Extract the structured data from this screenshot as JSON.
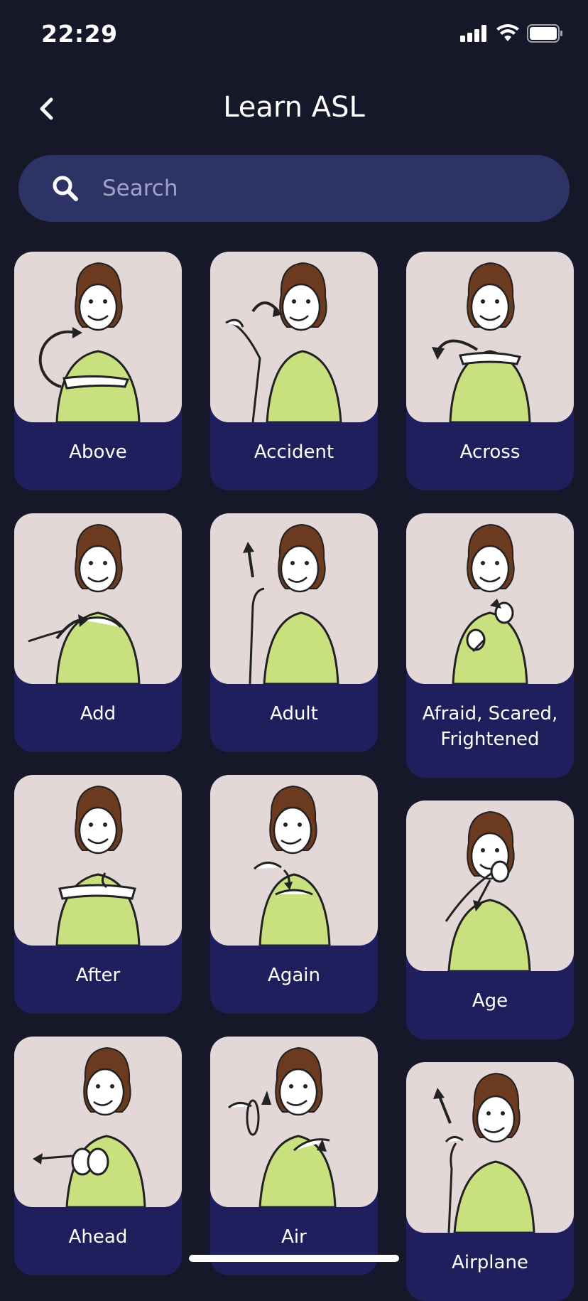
{
  "status": {
    "time": "22:29"
  },
  "header": {
    "title": "Learn ASL"
  },
  "search": {
    "placeholder": "Search"
  },
  "signs": [
    {
      "label": "Above"
    },
    {
      "label": "Accident"
    },
    {
      "label": "Across"
    },
    {
      "label": "Add"
    },
    {
      "label": "Adult"
    },
    {
      "label": "Afraid, Scared, Frightened"
    },
    {
      "label": "After"
    },
    {
      "label": "Again"
    },
    {
      "label": "Age"
    },
    {
      "label": "Ahead"
    },
    {
      "label": "Air"
    },
    {
      "label": "Airplane"
    }
  ],
  "colors": {
    "background": "#161729",
    "search_bg": "#2e3366",
    "card_bg": "#201f5d",
    "image_bg": "#e3d8d7",
    "shirt": "#c8e07e",
    "hair": "#6b3a1f"
  }
}
